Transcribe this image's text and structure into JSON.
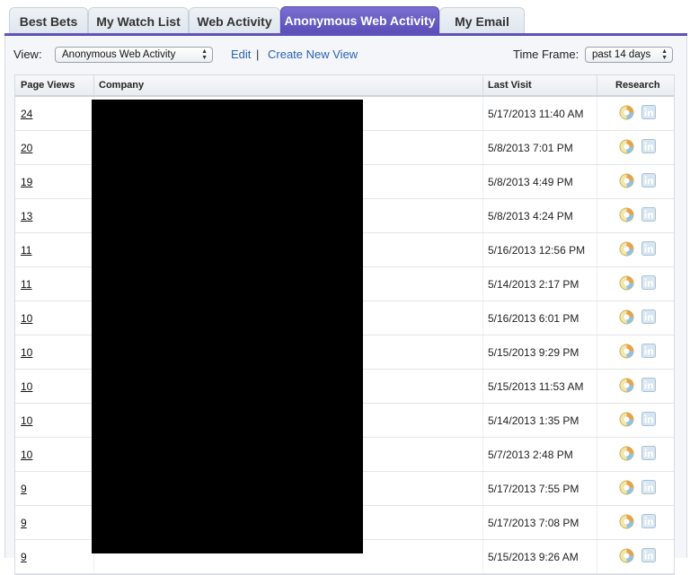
{
  "tabs": [
    {
      "label": "Best Bets",
      "active": false
    },
    {
      "label": "My Watch List",
      "active": false
    },
    {
      "label": "Web Activity",
      "active": false
    },
    {
      "label": "Anonymous Web Activity",
      "active": true
    },
    {
      "label": "My Email",
      "active": false
    }
  ],
  "toolbar": {
    "view_label": "View:",
    "view_selected": "Anonymous Web Activity",
    "edit_label": "Edit",
    "separator": "|",
    "create_label": "Create New View",
    "timeframe_label": "Time Frame:",
    "timeframe_selected": "past 14 days"
  },
  "table": {
    "headers": {
      "page_views": "Page Views",
      "company": "Company",
      "last_visit": "Last Visit",
      "research": "Research"
    },
    "rows": [
      {
        "page_views": "24",
        "last_visit": "5/17/2013 11:40 AM"
      },
      {
        "page_views": "20",
        "last_visit": "5/8/2013 7:01 PM"
      },
      {
        "page_views": "19",
        "last_visit": "5/8/2013 4:49 PM"
      },
      {
        "page_views": "13",
        "last_visit": "5/8/2013 4:24 PM"
      },
      {
        "page_views": "11",
        "last_visit": "5/16/2013 12:56 PM"
      },
      {
        "page_views": "11",
        "last_visit": "5/14/2013 2:17 PM"
      },
      {
        "page_views": "10",
        "last_visit": "5/16/2013 6:01 PM"
      },
      {
        "page_views": "10",
        "last_visit": "5/15/2013 9:29 PM"
      },
      {
        "page_views": "10",
        "last_visit": "5/15/2013 11:53 AM"
      },
      {
        "page_views": "10",
        "last_visit": "5/14/2013 1:35 PM"
      },
      {
        "page_views": "10",
        "last_visit": "5/7/2013 2:48 PM"
      },
      {
        "page_views": "9",
        "last_visit": "5/17/2013 7:55 PM"
      },
      {
        "page_views": "9",
        "last_visit": "5/17/2013 7:08 PM"
      },
      {
        "page_views": "9",
        "last_visit": "5/15/2013 9:26 AM"
      }
    ],
    "research_icons": [
      "data-com-icon",
      "linkedin-icon"
    ]
  },
  "colors": {
    "active_tab": "#5e52bb",
    "link": "#2a63b0"
  }
}
